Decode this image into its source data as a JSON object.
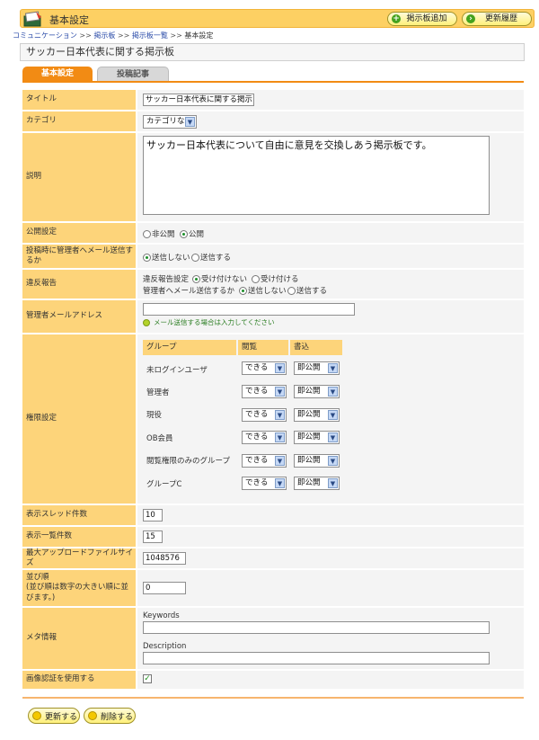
{
  "header": {
    "title": "基本設定",
    "add_board_label": "掲示板追加",
    "history_label": "更新履歴"
  },
  "breadcrumb": {
    "items": [
      "コミュニケーション",
      "掲示板",
      "掲示板一覧",
      "基本設定"
    ],
    "separator": ">>"
  },
  "board_title": "サッカー日本代表に関する掲示板",
  "tabs": {
    "basic": "基本設定",
    "posts": "投稿記事"
  },
  "form": {
    "title": {
      "label": "タイトル",
      "value": "サッカー日本代表に関する掲示"
    },
    "category": {
      "label": "カテゴリ",
      "value": "カテゴリなし"
    },
    "description": {
      "label": "説明",
      "value": "サッカー日本代表について自由に意見を交換しあう掲示板です。"
    },
    "visibility": {
      "label": "公開設定",
      "private": "非公開",
      "public": "公開",
      "selected": "公開"
    },
    "notify_admin": {
      "label": "投稿時に管理者へメール送信するか",
      "no": "送信しない",
      "yes": "送信する",
      "selected": "送信しない"
    },
    "violation": {
      "label": "違反報告",
      "setting_label": "違反報告設定",
      "reject": "受け付けない",
      "accept": "受け付ける",
      "setting_selected": "受け付けない",
      "mail_label": "管理者へメール送信するか",
      "mail_no": "送信しない",
      "mail_yes": "送信する",
      "mail_selected": "送信しない"
    },
    "admin_email": {
      "label": "管理者メールアドレス",
      "value": "",
      "hint": "メール送信する場合は入力してください"
    },
    "permissions": {
      "label": "権限設定",
      "headers": {
        "group": "グループ",
        "view": "閲覧",
        "write": "書込"
      },
      "rows": [
        {
          "group": "未ログインユーザ",
          "view": "できる",
          "write": "即公開"
        },
        {
          "group": "管理者",
          "view": "できる",
          "write": "即公開"
        },
        {
          "group": "現役",
          "view": "できる",
          "write": "即公開"
        },
        {
          "group": "OB会員",
          "view": "できる",
          "write": "即公開"
        },
        {
          "group": "閲覧権限のみのグループ",
          "view": "できる",
          "write": "即公開"
        },
        {
          "group": "グループC",
          "view": "できる",
          "write": "即公開"
        }
      ]
    },
    "thread_count": {
      "label": "表示スレッド件数",
      "value": "10"
    },
    "list_count": {
      "label": "表示一覧件数",
      "value": "15"
    },
    "max_upload": {
      "label": "最大アップロードファイルサイズ",
      "value": "1048576"
    },
    "order": {
      "label": "並び順\n(並び順は数字の大きい順に並びます。)",
      "value": "0"
    },
    "meta": {
      "label": "メタ情報",
      "keywords_label": "Keywords",
      "keywords_value": "",
      "description_label": "Description",
      "description_value": ""
    },
    "captcha": {
      "label": "画像認証を使用する",
      "checked": true
    }
  },
  "footer": {
    "update_label": "更新する",
    "delete_label": "削除する"
  },
  "colors": {
    "header_bg": "#fdd063",
    "tab_active": "#f28b14",
    "label_bg": "#fdd47a",
    "value_bg": "#f4f4f4",
    "accent_green": "#1d8f2a"
  }
}
